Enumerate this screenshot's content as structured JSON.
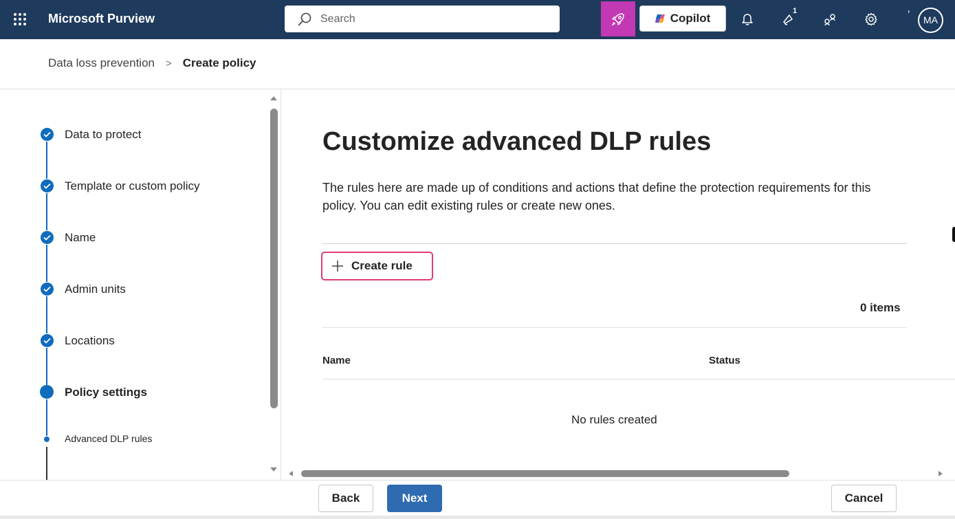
{
  "header": {
    "app_title": "Microsoft Purview",
    "search_placeholder": "Search",
    "copilot_label": "Copilot",
    "notification_badge": "1",
    "avatar_initials": "MA",
    "accent_color": "#1e3a5c",
    "rocket_color": "#c239b3"
  },
  "breadcrumb": {
    "parent": "Data loss prevention",
    "current": "Create policy"
  },
  "wizard": {
    "steps": [
      {
        "label": "Data to protect",
        "status": "completed"
      },
      {
        "label": "Template or custom policy",
        "status": "completed"
      },
      {
        "label": "Name",
        "status": "completed"
      },
      {
        "label": "Admin units",
        "status": "completed"
      },
      {
        "label": "Locations",
        "status": "completed"
      },
      {
        "label": "Policy settings",
        "status": "current"
      }
    ],
    "substep": {
      "label": "Advanced DLP rules",
      "status": "current"
    }
  },
  "main": {
    "title": "Customize advanced DLP rules",
    "description": "The rules here are made up of conditions and actions that define the protection requirements for this policy. You can edit existing rules or create new ones.",
    "create_rule_label": "Create rule",
    "items_count": "0 items",
    "columns": [
      "Name",
      "Status"
    ],
    "empty_message": "No rules created"
  },
  "footer": {
    "back_label": "Back",
    "next_label": "Next",
    "cancel_label": "Cancel"
  },
  "icons": [
    "waffle-icon",
    "search-icon",
    "rocket-icon",
    "copilot-icon",
    "bell-icon",
    "announcement-icon",
    "share-icon",
    "gear-icon",
    "checkmark-icon",
    "plus-icon"
  ]
}
